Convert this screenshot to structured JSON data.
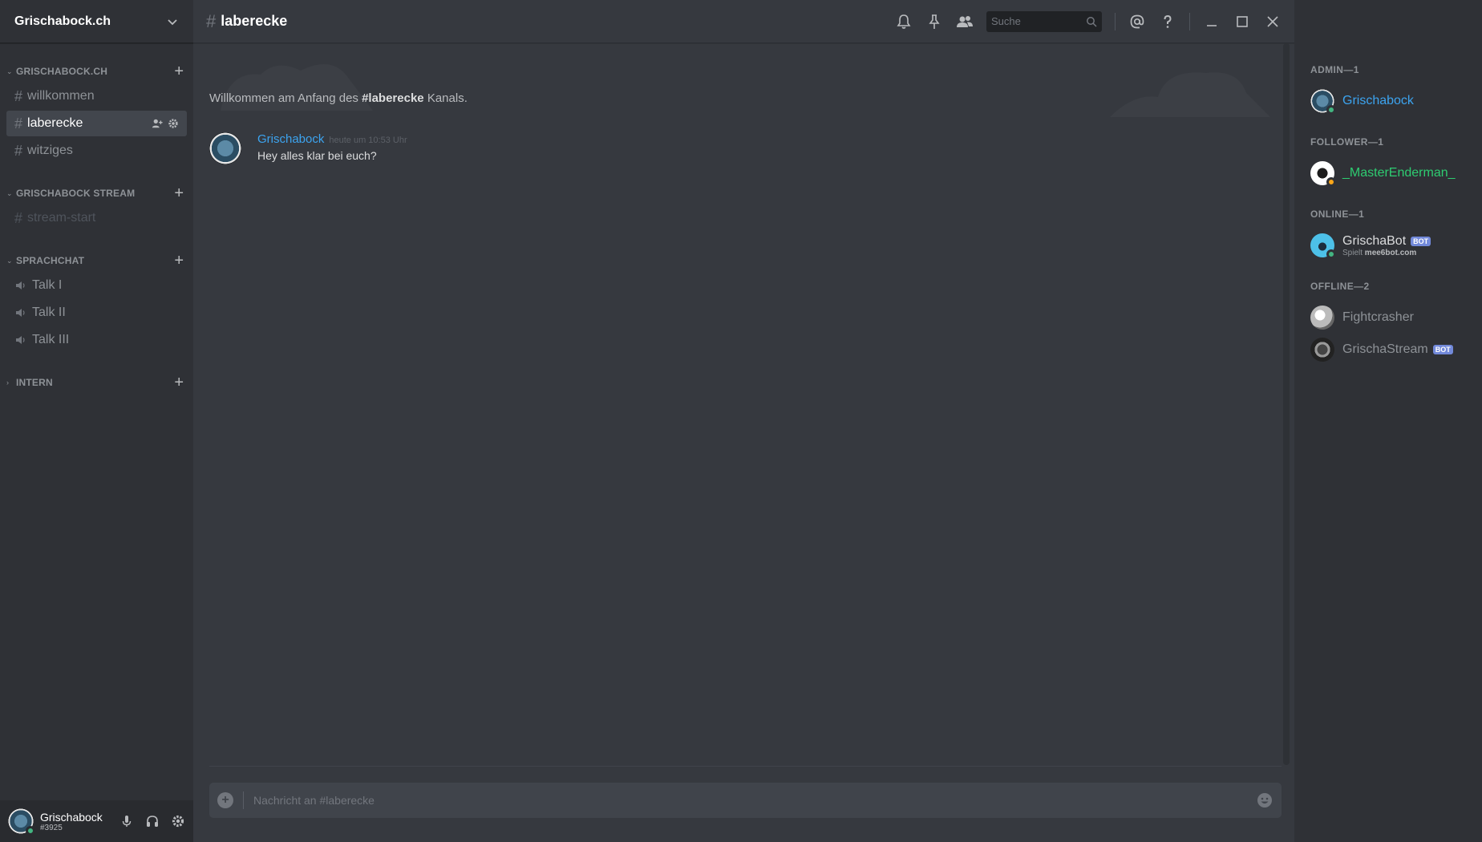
{
  "window": {
    "title": "Grischabock.ch"
  },
  "server": {
    "name": "Grischabock.ch"
  },
  "categories": [
    {
      "name": "GRISCHABOCK.CH",
      "channels": [
        {
          "name": "willkommen"
        },
        {
          "name": "laberecke"
        },
        {
          "name": "witziges"
        }
      ]
    },
    {
      "name": "GRISCHABOCK STREAM",
      "channels": [
        {
          "name": "stream-start"
        }
      ]
    },
    {
      "name": "SPRACHCHAT",
      "channels": [
        {
          "name": "Talk I"
        },
        {
          "name": "Talk II"
        },
        {
          "name": "Talk III"
        }
      ]
    },
    {
      "name": "INTERN",
      "channels": []
    }
  ],
  "user_panel": {
    "name": "Grischabock",
    "tag": "#3925"
  },
  "channel_header": {
    "hash": "#",
    "title": "laberecke",
    "search_placeholder": "Suche"
  },
  "welcome": {
    "prefix": "Willkommen am Anfang des ",
    "channel": "#laberecke",
    "suffix": " Kanals."
  },
  "message": {
    "author": "Grischabock",
    "time": "heute um 10:53 Uhr",
    "text": "Hey alles klar bei euch?"
  },
  "composer": {
    "placeholder": "Nachricht an #laberecke"
  },
  "members": {
    "admin": {
      "label": "ADMIN—1",
      "name": "Grischabock"
    },
    "follower": {
      "label": "FOLLOWER—1",
      "name": "_MasterEnderman_"
    },
    "online": {
      "label": "ONLINE—1",
      "name": "GrischaBot",
      "bot": "BOT",
      "activity_prefix": "Spielt ",
      "activity_game": "mee6bot.com"
    },
    "offline": {
      "label": "OFFLINE—2",
      "members": [
        {
          "name": "Fightcrasher"
        },
        {
          "name": "GrischaStream",
          "bot": "BOT"
        }
      ]
    }
  },
  "colors": {
    "accent_blue": "#3ca4f0",
    "follower_green": "#2ecc71",
    "online": "#43b581",
    "idle": "#faa61a",
    "bot_tag": "#7289da"
  }
}
